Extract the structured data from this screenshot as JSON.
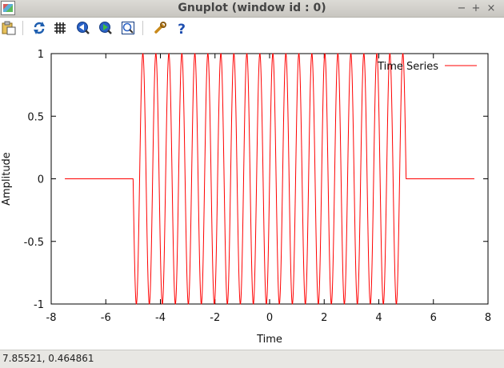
{
  "window": {
    "title": "Gnuplot (window id : 0)",
    "controls": [
      "−",
      "+",
      "×"
    ]
  },
  "toolbar": {
    "buttons": [
      {
        "name": "copy-to-clipboard",
        "icon": "clipboard-icon"
      },
      {
        "name": "replot",
        "icon": "replot-icon"
      },
      {
        "name": "toggle-grid",
        "icon": "grid-icon"
      },
      {
        "name": "previous-zoom",
        "icon": "zoom-previous-icon"
      },
      {
        "name": "next-zoom",
        "icon": "zoom-next-icon"
      },
      {
        "name": "autoscale",
        "icon": "autoscale-icon"
      },
      {
        "name": "settings",
        "icon": "wrench-icon"
      },
      {
        "name": "help",
        "icon": "help-icon"
      }
    ]
  },
  "status": {
    "coords": "7.85521,  0.464861"
  },
  "chart_data": {
    "type": "line",
    "title": "",
    "xlabel": "Time",
    "ylabel": "Amplitude",
    "xlim": [
      -8,
      8
    ],
    "ylim": [
      -1,
      1
    ],
    "xticks": [
      "-8",
      "-6",
      "-4",
      "-2",
      "0",
      "2",
      "4",
      "6",
      "8"
    ],
    "yticks": [
      "1",
      "0.5",
      "0",
      "-0.5",
      "-1"
    ],
    "grid": false,
    "legend": "top-right",
    "series": [
      {
        "name": "Time Series",
        "color": "#ff0000",
        "formula": "sin(2*pi*f*t) for |t| < 5, else 0",
        "frequency": 2.1,
        "x_range": [
          -7.5,
          7.5
        ],
        "active_range": [
          -5,
          5
        ]
      }
    ]
  }
}
